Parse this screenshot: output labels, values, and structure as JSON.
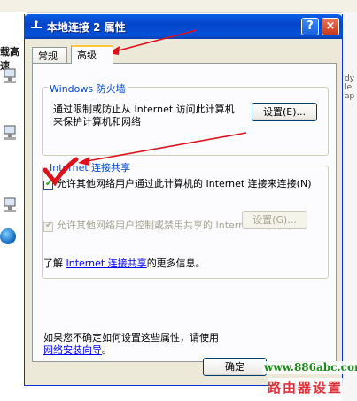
{
  "background": {
    "left_label": "载高速",
    "right_texts": [
      "dy",
      "le",
      "ap"
    ]
  },
  "window": {
    "title": "本地连接 2 属性",
    "help_label": "?",
    "close_label": "×"
  },
  "tabs": [
    {
      "label": "常规"
    },
    {
      "label": "高级"
    }
  ],
  "firewall": {
    "title": "Windows 防火墙",
    "description": "通过限制或防止从 Internet 访问此计算机来保护计算机和网络",
    "button_label": "设置(E)..."
  },
  "ics": {
    "title": "Internet 连接共享",
    "checkbox1_label": "允许其他网络用户通过此计算机的 Internet 连接来连接(N)",
    "checkbox1_checked": true,
    "checkbox2_label": "允许其他网络用户控制或禁用共享的 Internet 连接(O)",
    "checkbox2_checked": true,
    "learn_prefix": "了解",
    "learn_link": "Internet 连接共享",
    "learn_suffix": "的更多信息。",
    "button_label": "设置(G)..."
  },
  "footer": {
    "text": "如果您不确定如何设置这些属性，请使用",
    "link": "网络安装向导",
    "suffix": "。"
  },
  "ok_label": "确定",
  "watermark": {
    "url": "www.886abc.com",
    "caption": "路由器设置"
  },
  "colors": {
    "titlebar": "#0a5fe8",
    "annotation_red": "#e0101a",
    "group_title": "#0046d5"
  }
}
